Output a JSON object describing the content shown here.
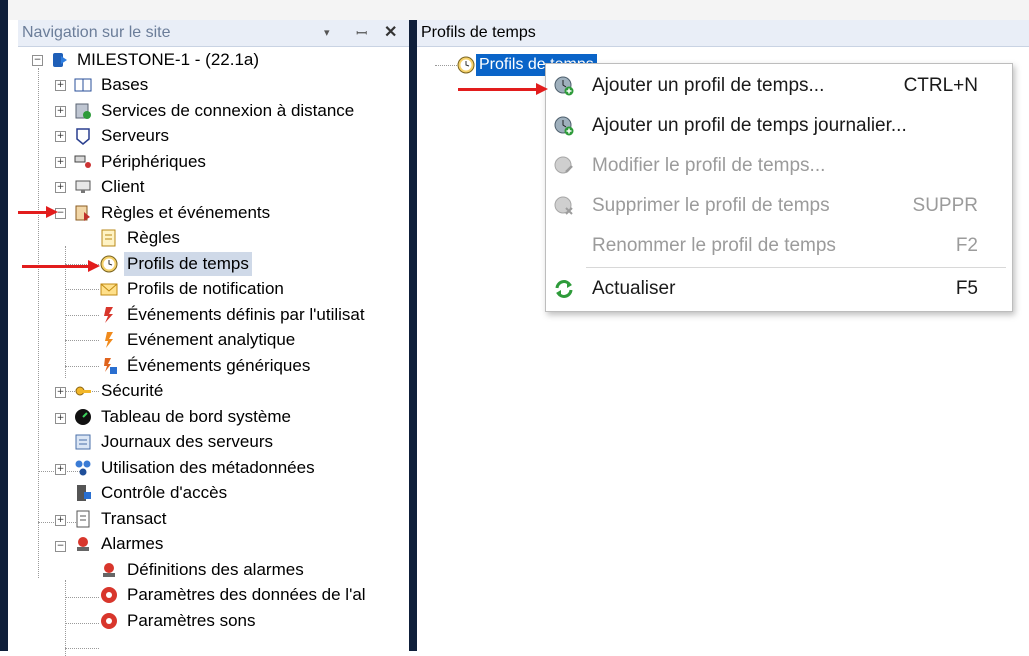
{
  "nav": {
    "title": "Navigation sur le site",
    "dropdown_glyph": "▾",
    "pin_glyph": "ꟷ",
    "close_glyph": "✕",
    "items": [
      {
        "label": "MILESTONE-1 - (22.1a)",
        "icon": "server-root-icon"
      },
      {
        "label": "Bases",
        "icon": "book-icon"
      },
      {
        "label": "Services de connexion à distance",
        "icon": "remote-connection-icon"
      },
      {
        "label": "Serveurs",
        "icon": "server-icon"
      },
      {
        "label": "Périphériques",
        "icon": "devices-icon"
      },
      {
        "label": "Client",
        "icon": "monitor-icon"
      },
      {
        "label": "Règles et événements",
        "icon": "rules-events-icon"
      },
      {
        "label": "Règles",
        "icon": "rules-icon"
      },
      {
        "label": "Profils de temps",
        "icon": "clock-icon"
      },
      {
        "label": "Profils de notification",
        "icon": "envelope-icon"
      },
      {
        "label": "Événements définis par l'utilisat",
        "icon": "user-event-icon"
      },
      {
        "label": "Evénement analytique",
        "icon": "analytic-event-icon"
      },
      {
        "label": "Événements génériques",
        "icon": "generic-event-icon"
      },
      {
        "label": "Sécurité",
        "icon": "security-icon"
      },
      {
        "label": "Tableau de bord système",
        "icon": "dashboard-icon"
      },
      {
        "label": "Journaux des serveurs",
        "icon": "log-icon"
      },
      {
        "label": "Utilisation des métadonnées",
        "icon": "metadata-icon"
      },
      {
        "label": "Contrôle d'accès",
        "icon": "access-control-icon"
      },
      {
        "label": "Transact",
        "icon": "receipt-icon"
      },
      {
        "label": "Alarmes",
        "icon": "alarm-icon"
      },
      {
        "label": "Définitions des alarmes",
        "icon": "alarm-definition-icon"
      },
      {
        "label": "Paramètres des données de l'al",
        "icon": "alarm-data-icon"
      },
      {
        "label": "Paramètres sons",
        "icon": "sound-settings-icon"
      }
    ]
  },
  "right": {
    "title": "Profils de temps",
    "root_item": "Profils de temps"
  },
  "context_menu": {
    "items": [
      {
        "label": "Ajouter un profil de temps...",
        "shortcut": "CTRL+N",
        "enabled": true,
        "icon": "add-clock-icon"
      },
      {
        "label": "Ajouter un profil de temps journalier...",
        "shortcut": "",
        "enabled": true,
        "icon": "add-daily-clock-icon"
      },
      {
        "label": "Modifier le profil de temps...",
        "shortcut": "",
        "enabled": false,
        "icon": "edit-clock-icon"
      },
      {
        "label": "Supprimer le profil de temps",
        "shortcut": "SUPPR",
        "enabled": false,
        "icon": "delete-clock-icon"
      },
      {
        "label": "Renommer le profil de temps",
        "shortcut": "F2",
        "enabled": false,
        "icon": ""
      },
      {
        "label": "Actualiser",
        "shortcut": "F5",
        "enabled": true,
        "icon": "refresh-icon"
      }
    ]
  },
  "colors": {
    "frame_dark": "#0f1f3a",
    "selection_blue": "#0a64c8",
    "annotation_red": "#e21d1d"
  }
}
